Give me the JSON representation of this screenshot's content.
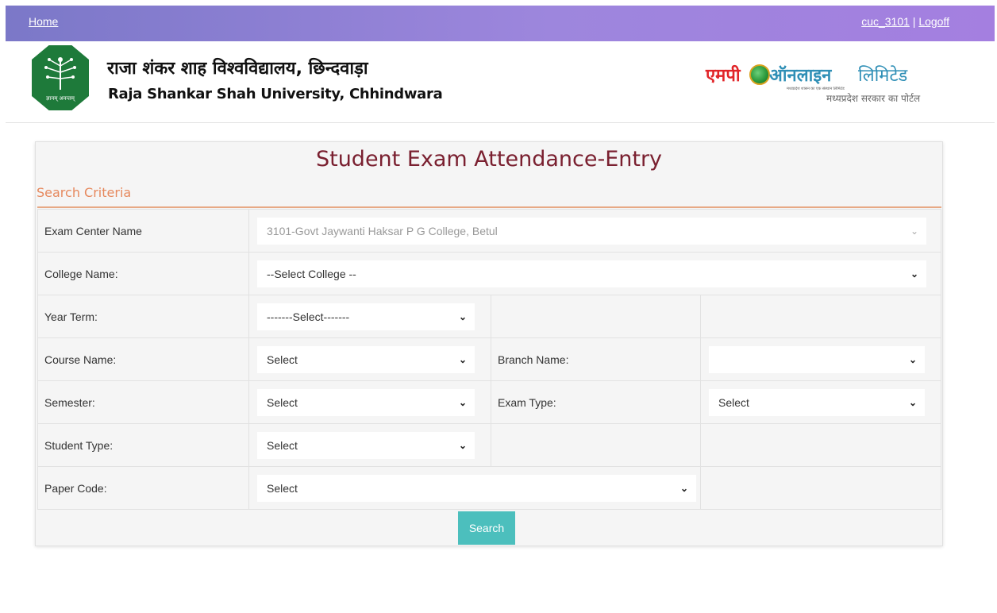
{
  "nav": {
    "home": "Home",
    "user": "cuc_3101",
    "separator": "|",
    "logoff": "Logoff"
  },
  "header": {
    "univ_name_hi": "राजा शंकर शाह विश्वविद्यालय, छिन्दवाड़ा",
    "univ_name_en": "Raja Shankar Shah University, Chhindwara",
    "univ_logo_motto": "ज्ञानम् अनन्तम्",
    "mp_logo": {
      "mp": "एमपी",
      "online": "ऑनलाइन",
      "limited": "लिमिटेड",
      "portal": "मध्यप्रदेश सरकार का पोर्टल",
      "tiny": "मध्यप्रदेश शासन का एक संस्थान लिमिटेड"
    }
  },
  "form": {
    "title": "Student Exam Attendance-Entry",
    "section": "Search Criteria",
    "exam_center": {
      "label": "Exam Center Name",
      "value": "3101-Govt Jaywanti Haksar P G College, Betul"
    },
    "college": {
      "label": "College Name:",
      "value": "--Select College --"
    },
    "year_term": {
      "label": "Year Term:",
      "value": "-------Select-------"
    },
    "course": {
      "label": "Course Name:",
      "value": "Select"
    },
    "branch": {
      "label": "Branch Name:",
      "value": ""
    },
    "semester": {
      "label": "Semester:",
      "value": "Select"
    },
    "exam_type": {
      "label": "Exam Type:",
      "value": "Select"
    },
    "student_type": {
      "label": "Student Type:",
      "value": "Select"
    },
    "paper_code": {
      "label": "Paper Code:",
      "value": "Select"
    },
    "search_button": "Search"
  },
  "colors": {
    "topbar": "#9d86dd",
    "title": "#7a2030",
    "section": "#e6895e",
    "button": "#4cbfbd"
  }
}
